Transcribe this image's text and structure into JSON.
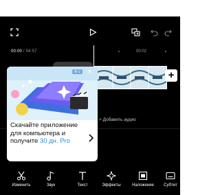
{
  "editor": {
    "current_time": "00:00",
    "time_separator": " / ",
    "total_time": "04:57",
    "ruler_tick_1": "00:02",
    "add_audio_label": "+ Добавить аудио"
  },
  "ad": {
    "timer": "6 с",
    "close": "✕",
    "text_main": "Скачайте приложение для компьютера и получите ",
    "text_accent": "30 дн. Pro",
    "accent_color": "#1f8fe6"
  },
  "toolbar": {
    "items": [
      {
        "label": "Изменить",
        "icon": "scissors-icon"
      },
      {
        "label": "Звук",
        "icon": "music-note-icon"
      },
      {
        "label": "Текст",
        "icon": "text-icon"
      },
      {
        "label": "Эффекты",
        "icon": "sparkle-icon"
      },
      {
        "label": "Наложение",
        "icon": "overlay-icon"
      },
      {
        "label": "Субтит",
        "icon": "subtitles-icon"
      }
    ]
  }
}
